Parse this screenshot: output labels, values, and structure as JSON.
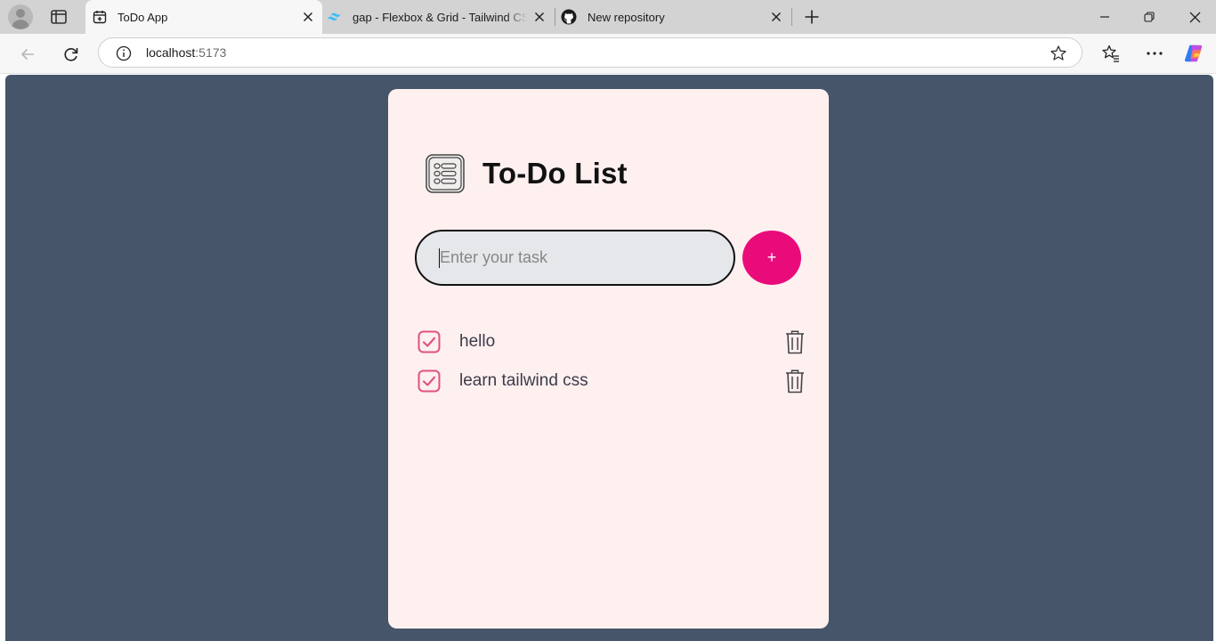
{
  "browser": {
    "tabs": [
      {
        "title": "ToDo App",
        "active": true
      },
      {
        "title": "gap - Flexbox & Grid - Tailwind CSS",
        "active": false
      },
      {
        "title": "New repository",
        "active": false
      }
    ],
    "url_host": "localhost",
    "url_port": ":5173"
  },
  "app": {
    "title": "To-Do List",
    "input_placeholder": "Enter your task",
    "add_label": "+",
    "tasks": [
      {
        "text": "hello",
        "done": true
      },
      {
        "text": "learn tailwind css",
        "done": true
      }
    ]
  },
  "colors": {
    "page_background": "#465569",
    "card_background": "#fff0f0",
    "accent": "#ea0b7b",
    "checkbox": "#e0527c"
  },
  "icons": [
    "profile-icon",
    "tab-actions-icon",
    "calendar-icon",
    "tailwind-icon",
    "github-icon",
    "close-icon",
    "plus-icon",
    "minimize-icon",
    "restore-icon",
    "back-icon",
    "refresh-icon",
    "info-icon",
    "star-icon",
    "favorites-icon",
    "more-icon",
    "copilot-icon",
    "list-icon",
    "checkbox-icon",
    "trash-icon"
  ]
}
